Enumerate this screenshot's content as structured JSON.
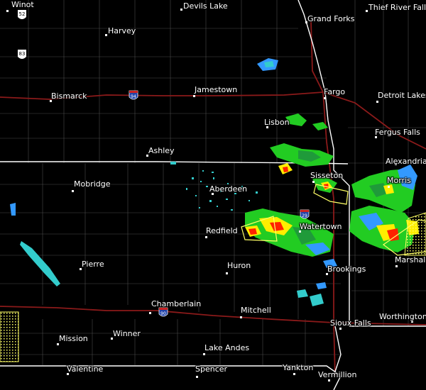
{
  "colors": {
    "background": "#000000",
    "county_line": "#4a4a4a",
    "state_line": "#ffffff",
    "interstate": "#8b1a1a",
    "radar_green": "#22cc22",
    "radar_yellow": "#ffee00",
    "radar_red": "#ff2200",
    "radar_blue": "#3399ff",
    "radar_cyan": "#33cccc",
    "warning_outline": "#ffff66"
  },
  "cities": [
    {
      "name": "Winot"
    },
    {
      "name": "Devils Lake"
    },
    {
      "name": "Grand Forks"
    },
    {
      "name": "Thief River Falls"
    },
    {
      "name": "Harvey"
    },
    {
      "name": "Bismarck"
    },
    {
      "name": "Jamestown"
    },
    {
      "name": "Fargo"
    },
    {
      "name": "Detroit Lakes"
    },
    {
      "name": "Lisbon"
    },
    {
      "name": "Fergus Falls"
    },
    {
      "name": "Ashley"
    },
    {
      "name": "Alexandria"
    },
    {
      "name": "Sisseton"
    },
    {
      "name": "Mobridge"
    },
    {
      "name": "Aberdeen"
    },
    {
      "name": "Morris"
    },
    {
      "name": "Redfield"
    },
    {
      "name": "Watertown"
    },
    {
      "name": "Pierre"
    },
    {
      "name": "Huron"
    },
    {
      "name": "Brookings"
    },
    {
      "name": "Marshall"
    },
    {
      "name": "Chamberlain"
    },
    {
      "name": "Mitchell"
    },
    {
      "name": "Worthington"
    },
    {
      "name": "Mission"
    },
    {
      "name": "Winner"
    },
    {
      "name": "Sioux Falls"
    },
    {
      "name": "Lake Andes"
    },
    {
      "name": "Valentine"
    },
    {
      "name": "Spencer"
    },
    {
      "name": "Yankton"
    },
    {
      "name": "Vermillion"
    }
  ],
  "shields": [
    {
      "label": "52",
      "type": "us-highway-shield"
    },
    {
      "label": "83",
      "type": "us-highway-shield"
    },
    {
      "label": "94",
      "type": "interstate-shield"
    },
    {
      "label": "29",
      "type": "interstate-shield"
    },
    {
      "label": "90",
      "type": "interstate-shield"
    }
  ]
}
